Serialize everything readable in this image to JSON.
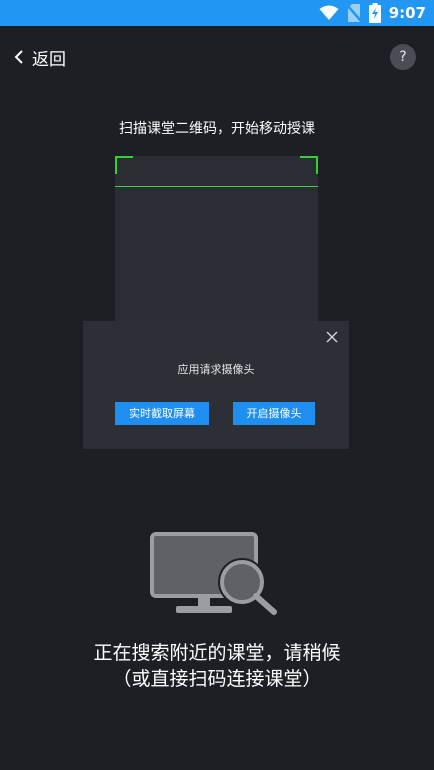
{
  "status_bar": {
    "time": "9:07",
    "bg_color": "#2196f3",
    "icons": [
      "wifi-icon",
      "no-sim-icon",
      "battery-charging-icon"
    ]
  },
  "header": {
    "back_label": "返回",
    "help_label": "?"
  },
  "scanner": {
    "title": "扫描课堂二维码，开始移动授课",
    "frame_color": "#2fd22f"
  },
  "dialog": {
    "message": "应用请求摄像头",
    "screen_capture_button": "实时截取屏幕",
    "open_camera_button": "开启摄像头",
    "button_color": "#1f8ef1"
  },
  "search_status": {
    "line1": "正在搜索附近的课堂，请稍候",
    "line2": "（或直接扫码连接课堂）"
  }
}
